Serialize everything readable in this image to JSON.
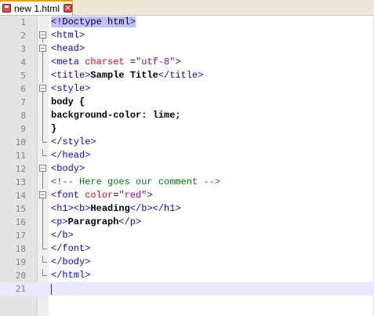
{
  "tab": {
    "label": "new 1.html",
    "icon": "document-icon",
    "close_icon": "close-icon"
  },
  "colors": {
    "tag": "#0000ff",
    "attribute": "#ff0000",
    "string": "#8000ff",
    "comment": "#008000",
    "text": "#000000",
    "current_line": "#e8e8ff"
  },
  "editor": {
    "current_line": 21,
    "lines": [
      {
        "num": "1",
        "parts": [
          [
            "tag hl",
            "<!"
          ],
          [
            "plain hl",
            "Doctype html"
          ],
          [
            "tag hl",
            ">"
          ]
        ]
      },
      {
        "num": "2",
        "parts": [
          [
            "tag",
            "<html>"
          ]
        ]
      },
      {
        "num": "3",
        "parts": [
          [
            "tag",
            "<head>"
          ]
        ]
      },
      {
        "num": "4",
        "parts": [
          [
            "tag",
            "<meta "
          ],
          [
            "attr",
            "charset"
          ],
          [
            "plain",
            " ="
          ],
          [
            "str",
            "\"utf-8\""
          ],
          [
            "tag",
            ">"
          ]
        ]
      },
      {
        "num": "5",
        "parts": [
          [
            "tag",
            "<title>"
          ],
          [
            "txt",
            "Sample Title"
          ],
          [
            "tag",
            "</title>"
          ]
        ]
      },
      {
        "num": "6",
        "parts": [
          [
            "tag",
            "<style>"
          ]
        ]
      },
      {
        "num": "7",
        "parts": [
          [
            "txt",
            "body {"
          ]
        ]
      },
      {
        "num": "8",
        "parts": [
          [
            "txt",
            "background-color: lime;"
          ]
        ]
      },
      {
        "num": "9",
        "parts": [
          [
            "txt",
            "}"
          ]
        ]
      },
      {
        "num": "10",
        "parts": [
          [
            "tag",
            "</style>"
          ]
        ]
      },
      {
        "num": "11",
        "parts": [
          [
            "tag",
            "</head>"
          ]
        ]
      },
      {
        "num": "12",
        "parts": [
          [
            "tag",
            "<body>"
          ]
        ]
      },
      {
        "num": "13",
        "parts": [
          [
            "cmt",
            "<!-- Here goes our comment -->"
          ]
        ]
      },
      {
        "num": "14",
        "parts": [
          [
            "tag",
            "<font "
          ],
          [
            "attr",
            "color"
          ],
          [
            "plain",
            "="
          ],
          [
            "str",
            "\"red\""
          ],
          [
            "tag",
            ">"
          ]
        ]
      },
      {
        "num": "15",
        "parts": [
          [
            "tag",
            "<h1><b>"
          ],
          [
            "txt",
            "Heading"
          ],
          [
            "tag",
            "</b></h1>"
          ]
        ]
      },
      {
        "num": "16",
        "parts": [
          [
            "tag",
            "<p>"
          ],
          [
            "txt",
            "Paragraph"
          ],
          [
            "tag",
            "</p>"
          ]
        ]
      },
      {
        "num": "17",
        "parts": [
          [
            "tag",
            "</b>"
          ]
        ]
      },
      {
        "num": "18",
        "parts": [
          [
            "tag",
            "</font>"
          ]
        ]
      },
      {
        "num": "19",
        "parts": [
          [
            "tag",
            "</body>"
          ]
        ]
      },
      {
        "num": "20",
        "parts": [
          [
            "tag",
            "</html>"
          ]
        ]
      },
      {
        "num": "21",
        "parts": []
      }
    ],
    "folds": {
      "2": "open",
      "3": "open",
      "4": "mid",
      "5": "mid",
      "6": "open",
      "7": "mid",
      "8": "mid",
      "9": "mid",
      "10": "end",
      "11": "end",
      "12": "open",
      "13": "mid",
      "14": "open",
      "15": "mid",
      "16": "mid",
      "17": "mid",
      "18": "end",
      "19": "end",
      "20": "end"
    }
  }
}
